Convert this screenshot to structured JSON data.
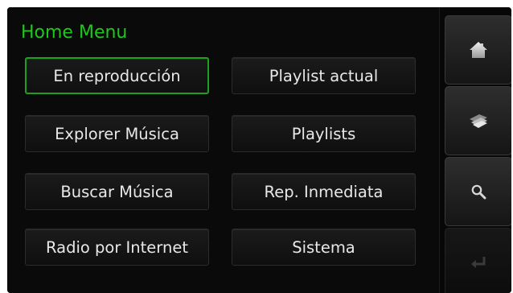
{
  "header": {
    "title": "Home Menu"
  },
  "menu": {
    "now_playing": "En reproducción",
    "current_playlist": "Playlist actual",
    "explore_music": "Explorer Música",
    "playlists": "Playlists",
    "search_music": "Buscar Música",
    "instant_play": "Rep. Inmediata",
    "internet_radio": "Radio por Internet",
    "system": "Sistema"
  },
  "sidebar": {
    "icons": [
      "home-icon",
      "music-library-icon",
      "search-icon",
      "back-arrow-icon"
    ]
  },
  "colors": {
    "accent": "#1ec61e",
    "selected_border": "#1ea01e",
    "button_text": "#e8e8e8",
    "background": "#050505"
  }
}
